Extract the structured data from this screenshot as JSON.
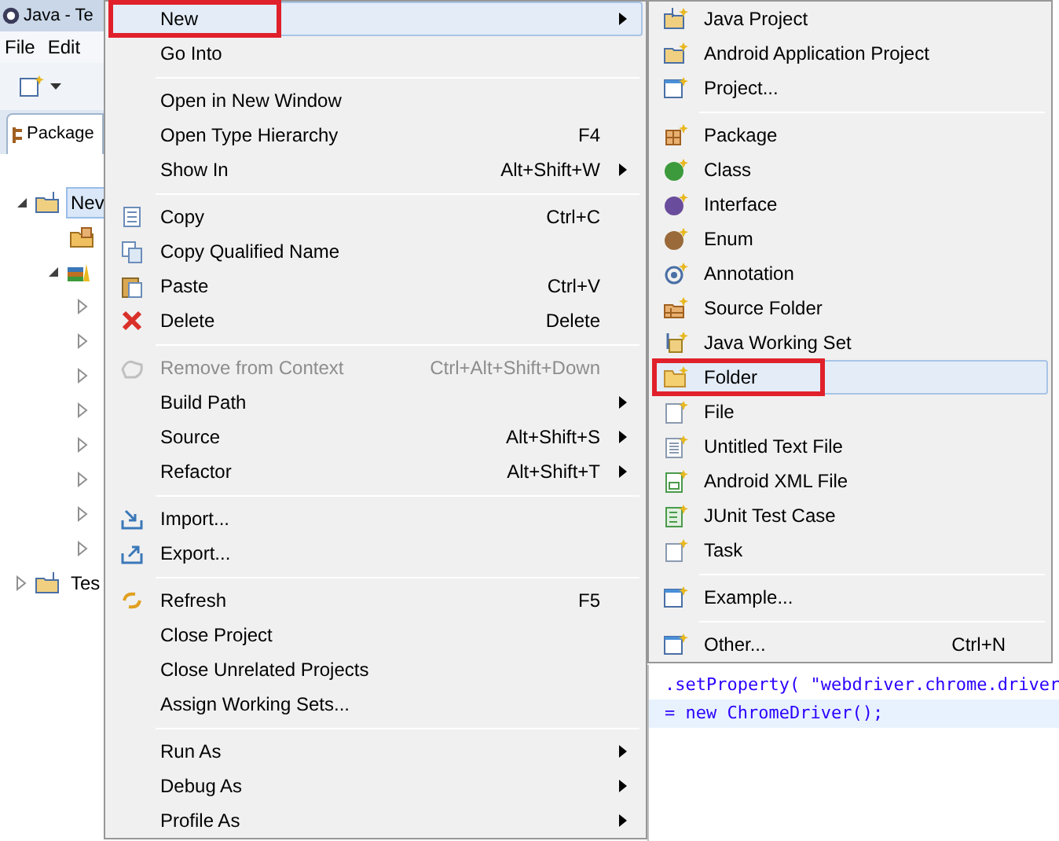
{
  "window": {
    "title": "Java - Te"
  },
  "menubar": [
    "File",
    "Edit"
  ],
  "view_tab": {
    "label": "Package"
  },
  "tree": [
    {
      "kind": "project",
      "label": "Nev",
      "selected": true,
      "expanded": true,
      "children": [
        {
          "kind": "folder"
        },
        {
          "kind": "library",
          "expanded": true,
          "children": [
            {
              "kind": "jar",
              "expanded": false
            },
            {
              "kind": "jar",
              "expanded": false
            },
            {
              "kind": "jar",
              "expanded": false
            },
            {
              "kind": "jar",
              "expanded": false
            },
            {
              "kind": "jar",
              "expanded": false
            },
            {
              "kind": "jar",
              "expanded": false
            },
            {
              "kind": "jar",
              "expanded": false
            },
            {
              "kind": "jar",
              "expanded": false
            }
          ]
        }
      ]
    },
    {
      "kind": "project",
      "label": "Tes",
      "selected": false,
      "expanded": false
    }
  ],
  "editor": {
    "lines": [
      ".setProperty( \"webdriver.chrome.driver",
      "= new ChromeDriver();"
    ]
  },
  "context_menu": [
    {
      "kind": "item",
      "label": "New",
      "selected": true,
      "marked": true,
      "submenu": true
    },
    {
      "kind": "item",
      "label": "Go Into"
    },
    {
      "kind": "separator"
    },
    {
      "kind": "item",
      "label": "Open in New Window"
    },
    {
      "kind": "item",
      "label": "Open Type Hierarchy",
      "shortcut": "F4"
    },
    {
      "kind": "item",
      "label": "Show In",
      "shortcut": "Alt+Shift+W",
      "submenu": true
    },
    {
      "kind": "separator"
    },
    {
      "kind": "item",
      "label": "Copy",
      "shortcut": "Ctrl+C"
    },
    {
      "kind": "item",
      "label": "Copy Qualified Name"
    },
    {
      "kind": "item",
      "label": "Paste",
      "shortcut": "Ctrl+V"
    },
    {
      "kind": "item",
      "label": "Delete",
      "shortcut": "Delete"
    },
    {
      "kind": "separator"
    },
    {
      "kind": "item",
      "label": "Remove from Context",
      "shortcut": "Ctrl+Alt+Shift+Down",
      "disabled": true
    },
    {
      "kind": "item",
      "label": "Build Path",
      "submenu": true
    },
    {
      "kind": "item",
      "label": "Source",
      "shortcut": "Alt+Shift+S",
      "submenu": true
    },
    {
      "kind": "item",
      "label": "Refactor",
      "shortcut": "Alt+Shift+T",
      "submenu": true
    },
    {
      "kind": "separator"
    },
    {
      "kind": "item",
      "label": "Import..."
    },
    {
      "kind": "item",
      "label": "Export..."
    },
    {
      "kind": "separator"
    },
    {
      "kind": "item",
      "label": "Refresh",
      "shortcut": "F5"
    },
    {
      "kind": "item",
      "label": "Close Project"
    },
    {
      "kind": "item",
      "label": "Close Unrelated Projects"
    },
    {
      "kind": "item",
      "label": "Assign Working Sets..."
    },
    {
      "kind": "separator"
    },
    {
      "kind": "item",
      "label": "Run As",
      "submenu": true
    },
    {
      "kind": "item",
      "label": "Debug As",
      "submenu": true
    },
    {
      "kind": "item",
      "label": "Profile As",
      "submenu": true
    }
  ],
  "new_submenu": [
    {
      "kind": "item",
      "label": "Java Project"
    },
    {
      "kind": "item",
      "label": "Android Application Project"
    },
    {
      "kind": "item",
      "label": "Project..."
    },
    {
      "kind": "separator"
    },
    {
      "kind": "item",
      "label": "Package"
    },
    {
      "kind": "item",
      "label": "Class"
    },
    {
      "kind": "item",
      "label": "Interface"
    },
    {
      "kind": "item",
      "label": "Enum"
    },
    {
      "kind": "item",
      "label": "Annotation"
    },
    {
      "kind": "item",
      "label": "Source Folder"
    },
    {
      "kind": "item",
      "label": "Java Working Set"
    },
    {
      "kind": "item",
      "label": "Folder",
      "selected": true,
      "marked": true
    },
    {
      "kind": "item",
      "label": "File"
    },
    {
      "kind": "item",
      "label": "Untitled Text File"
    },
    {
      "kind": "item",
      "label": "Android XML File"
    },
    {
      "kind": "item",
      "label": "JUnit Test Case"
    },
    {
      "kind": "item",
      "label": "Task"
    },
    {
      "kind": "separator"
    },
    {
      "kind": "item",
      "label": "Example..."
    },
    {
      "kind": "separator"
    },
    {
      "kind": "item",
      "label": "Other...",
      "shortcut": "Ctrl+N"
    }
  ]
}
